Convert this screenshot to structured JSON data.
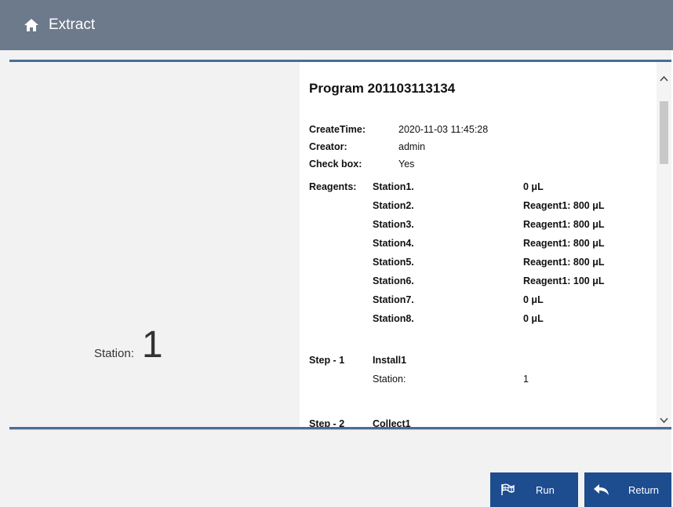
{
  "header": {
    "title": "Extract",
    "icon": "home-icon"
  },
  "station": {
    "label": "Station:",
    "value": "1"
  },
  "program": {
    "title": "Program 201103113134",
    "create_time_label": "CreateTime:",
    "create_time": "2020-11-03 11:45:28",
    "creator_label": "Creator:",
    "creator": "admin",
    "check_box_label": "Check box:",
    "check_box": "Yes",
    "reagents_label": "Reagents:",
    "reagents": [
      {
        "station": "Station1.",
        "value": "0 μL"
      },
      {
        "station": "Station2.",
        "value": "Reagent1: 800 μL"
      },
      {
        "station": "Station3.",
        "value": "Reagent1: 800 μL"
      },
      {
        "station": "Station4.",
        "value": "Reagent1: 800 μL"
      },
      {
        "station": "Station5.",
        "value": "Reagent1: 800 μL"
      },
      {
        "station": "Station6.",
        "value": "Reagent1: 100 μL"
      },
      {
        "station": "Station7.",
        "value": "0 μL"
      },
      {
        "station": "Station8.",
        "value": "0 μL"
      }
    ],
    "steps": [
      {
        "label": "Step - 1",
        "name": "Install1",
        "field_label": "Station:",
        "field_value": "1"
      },
      {
        "label": "Step - 2",
        "name": "Collect1"
      }
    ]
  },
  "buttons": {
    "run": "Run",
    "return": "Return"
  },
  "colors": {
    "header": "#6c7a8b",
    "accent": "#4a6d95",
    "button": "#1d4c8f"
  }
}
